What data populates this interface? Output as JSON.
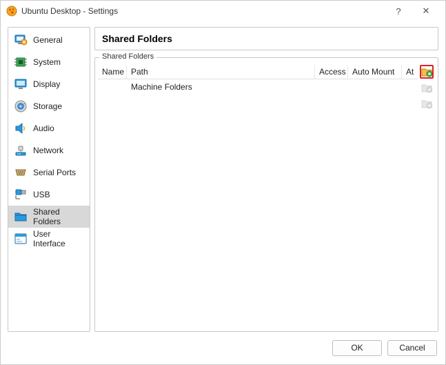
{
  "window": {
    "title": "Ubuntu Desktop - Settings",
    "help": "?",
    "close": "✕"
  },
  "sidebar": {
    "items": [
      {
        "label": "General"
      },
      {
        "label": "System"
      },
      {
        "label": "Display"
      },
      {
        "label": "Storage"
      },
      {
        "label": "Audio"
      },
      {
        "label": "Network"
      },
      {
        "label": "Serial Ports"
      },
      {
        "label": "USB"
      },
      {
        "label": "Shared Folders"
      },
      {
        "label": "User Interface"
      }
    ]
  },
  "main": {
    "heading": "Shared Folders",
    "group_label": "Shared Folders",
    "columns": {
      "name": "Name",
      "path": "Path",
      "access": "Access",
      "auto": "Auto Mount",
      "at": "At"
    },
    "rows": [
      {
        "path": "Machine Folders"
      }
    ]
  },
  "footer": {
    "ok": "OK",
    "cancel": "Cancel"
  }
}
